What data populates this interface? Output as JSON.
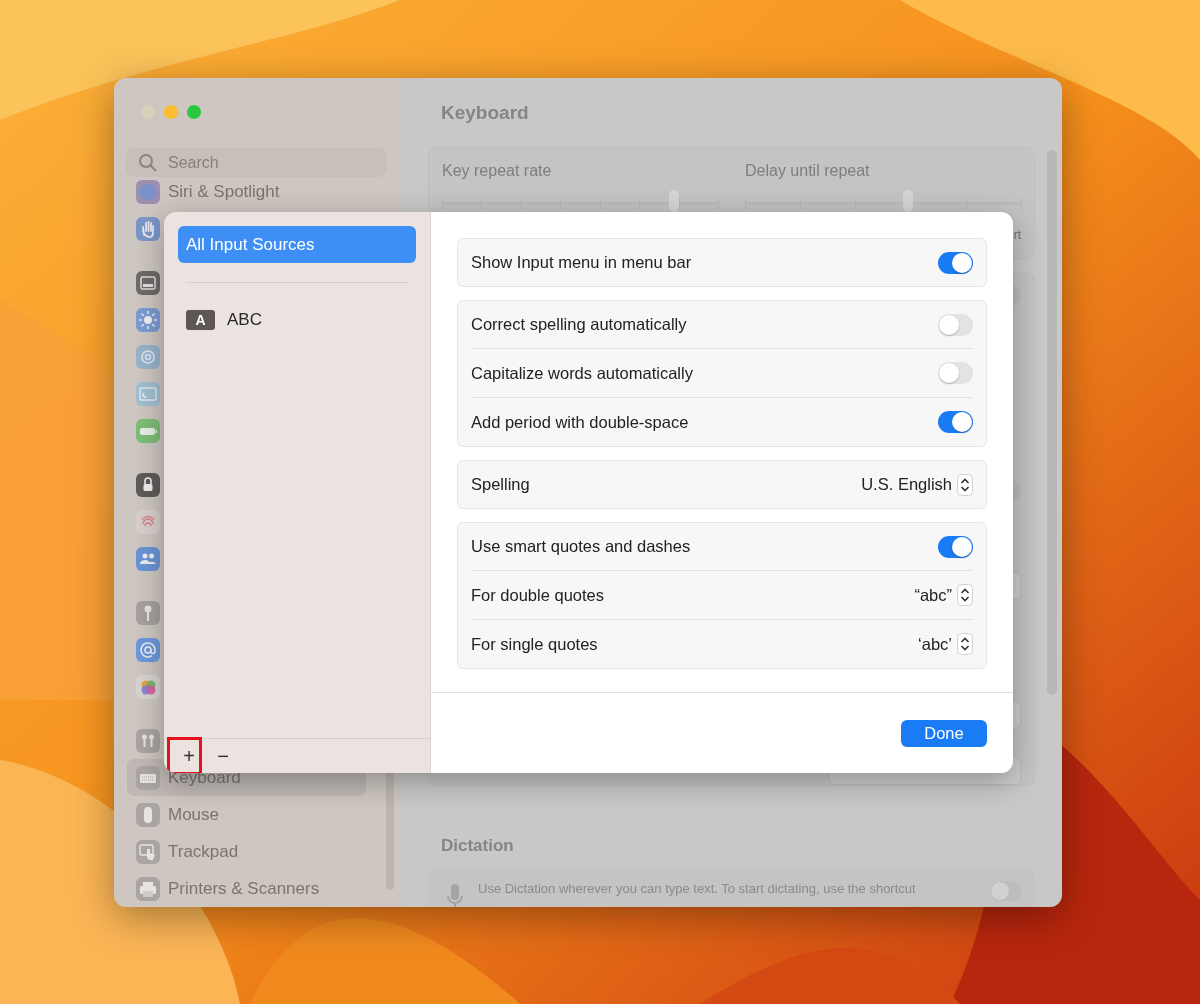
{
  "window": {
    "traffic_lights": [
      {
        "kind": "close",
        "disabled": true
      },
      {
        "kind": "minimize",
        "disabled": false
      },
      {
        "kind": "zoom",
        "disabled": false
      }
    ]
  },
  "sidebar": {
    "search": {
      "placeholder": "Search"
    },
    "groups": [
      [
        {
          "label": "Siri & Spotlight",
          "selected": false
        },
        {
          "selected": false
        }
      ],
      [
        {
          "selected": false
        },
        {
          "selected": false
        },
        {
          "selected": false
        },
        {
          "selected": false
        },
        {
          "selected": false
        }
      ],
      [
        {
          "selected": false
        },
        {
          "selected": false
        },
        {
          "selected": false
        }
      ],
      [
        {
          "selected": false
        },
        {
          "selected": false
        },
        {
          "selected": false
        }
      ],
      [
        {
          "selected": false
        },
        {
          "label": "Keyboard",
          "selected": true
        },
        {
          "label": "Mouse",
          "selected": false
        },
        {
          "label": "Trackpad",
          "selected": false
        },
        {
          "label": "Printers & Scanners",
          "selected": false
        }
      ]
    ]
  },
  "content": {
    "title": "Keyboard",
    "sliders": [
      {
        "label": "Key repeat rate",
        "level": 0.84
      },
      {
        "label": "Delay until repeat",
        "level": 0.59,
        "end_label": "rt"
      }
    ],
    "background_toggles": [
      {
        "on": false
      },
      {
        "on": false
      }
    ],
    "dictation": {
      "heading": "Dictation",
      "description": "Use Dictation wherever you can type text. To start dictating, use the shortcut",
      "on": false
    }
  },
  "dialog": {
    "sources": [
      {
        "kind": "all",
        "label": "All Input Sources",
        "selected": true
      },
      {
        "kind": "source",
        "badge": "A",
        "label": "ABC",
        "selected": false
      }
    ],
    "add_button": {
      "label": "+",
      "highlighted": true
    },
    "remove_button": {
      "label": "−",
      "highlighted": false
    },
    "groups": [
      [
        {
          "kind": "toggle",
          "label": "Show Input menu in menu bar",
          "on": true
        }
      ],
      [
        {
          "kind": "toggle",
          "label": "Correct spelling automatically",
          "on": false
        },
        {
          "kind": "toggle",
          "label": "Capitalize words automatically",
          "on": false
        },
        {
          "kind": "toggle",
          "label": "Add period with double-space",
          "on": true
        }
      ],
      [
        {
          "kind": "popup",
          "label": "Spelling",
          "value": "U.S. English"
        }
      ],
      [
        {
          "kind": "toggle",
          "label": "Use smart quotes and dashes",
          "on": true
        },
        {
          "kind": "popup",
          "label": "For double quotes",
          "value": "“abc”"
        },
        {
          "kind": "popup",
          "label": "For single quotes",
          "value": "‘abc’"
        }
      ]
    ],
    "done_button": "Done"
  }
}
